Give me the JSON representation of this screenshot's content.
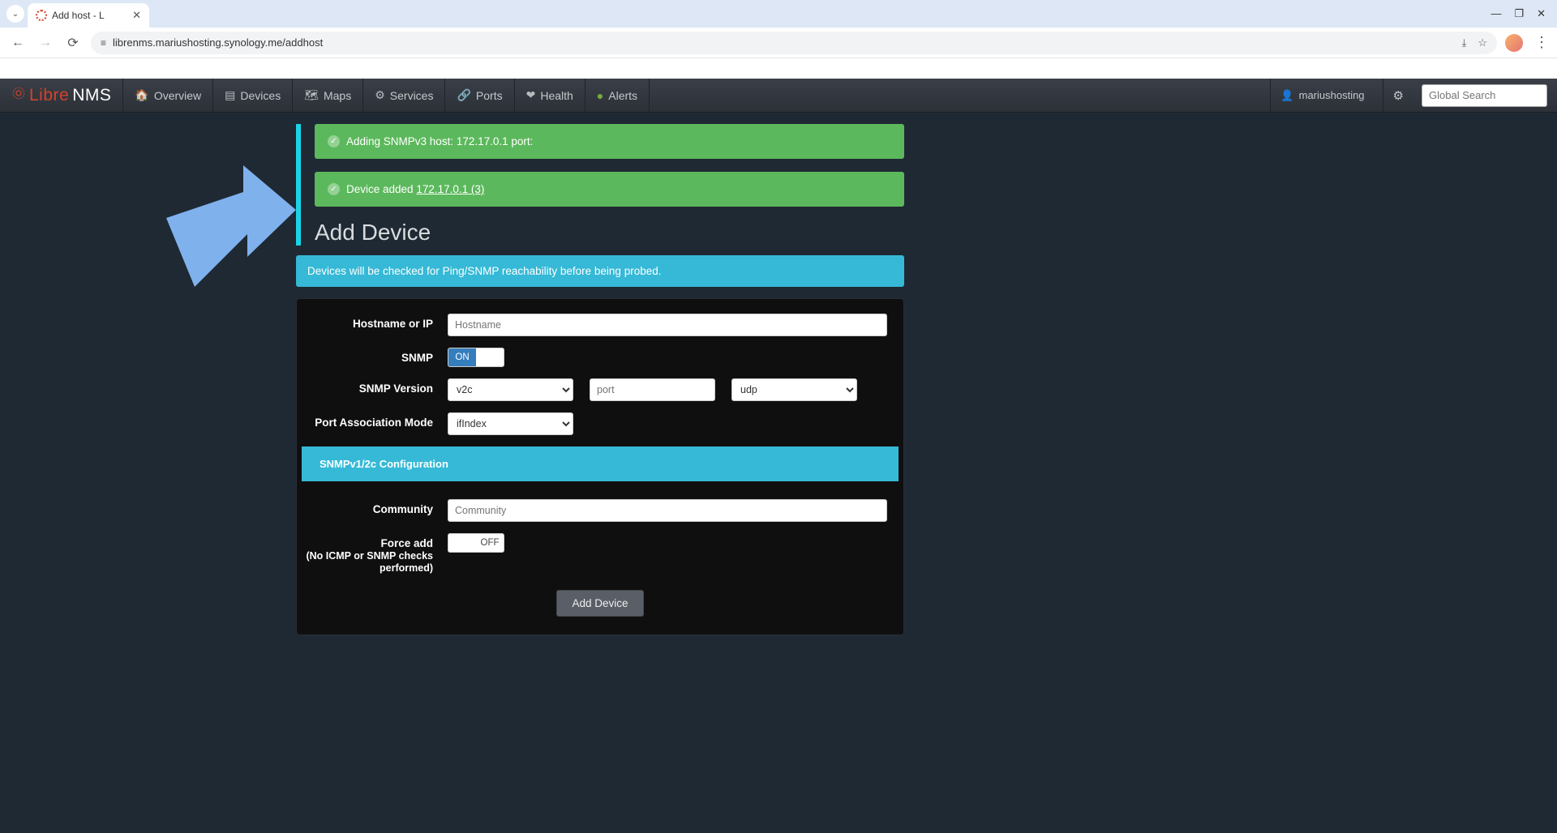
{
  "browser": {
    "tab_title": "Add host - L",
    "url": "librenms.mariushosting.synology.me/addhost"
  },
  "nav": {
    "logo1": "Libre",
    "logo2": "NMS",
    "items": {
      "overview": "Overview",
      "devices": "Devices",
      "maps": "Maps",
      "services": "Services",
      "ports": "Ports",
      "health": "Health",
      "alerts": "Alerts"
    },
    "username": "mariushosting",
    "search_placeholder": "Global Search"
  },
  "alerts": {
    "msg1": "Adding SNMPv3 host: 172.17.0.1 port:",
    "msg2_prefix": "Device added ",
    "msg2_link": "172.17.0.1 (3)"
  },
  "page": {
    "title": "Add Device",
    "info": "Devices will be checked for Ping/SNMP reachability before being probed."
  },
  "form": {
    "hostname_label": "Hostname or IP",
    "hostname_placeholder": "Hostname",
    "snmp_label": "SNMP",
    "snmp_toggle": "ON",
    "snmp_version_label": "SNMP Version",
    "snmp_version_value": "v2c",
    "port_placeholder": "port",
    "transport_value": "udp",
    "pam_label": "Port Association Mode",
    "pam_value": "ifIndex",
    "section_head": "SNMPv1/2c Configuration",
    "community_label": "Community",
    "community_placeholder": "Community",
    "force_label": "Force add",
    "force_sub": "(No ICMP or SNMP checks performed)",
    "force_toggle": "OFF",
    "submit": "Add Device"
  }
}
